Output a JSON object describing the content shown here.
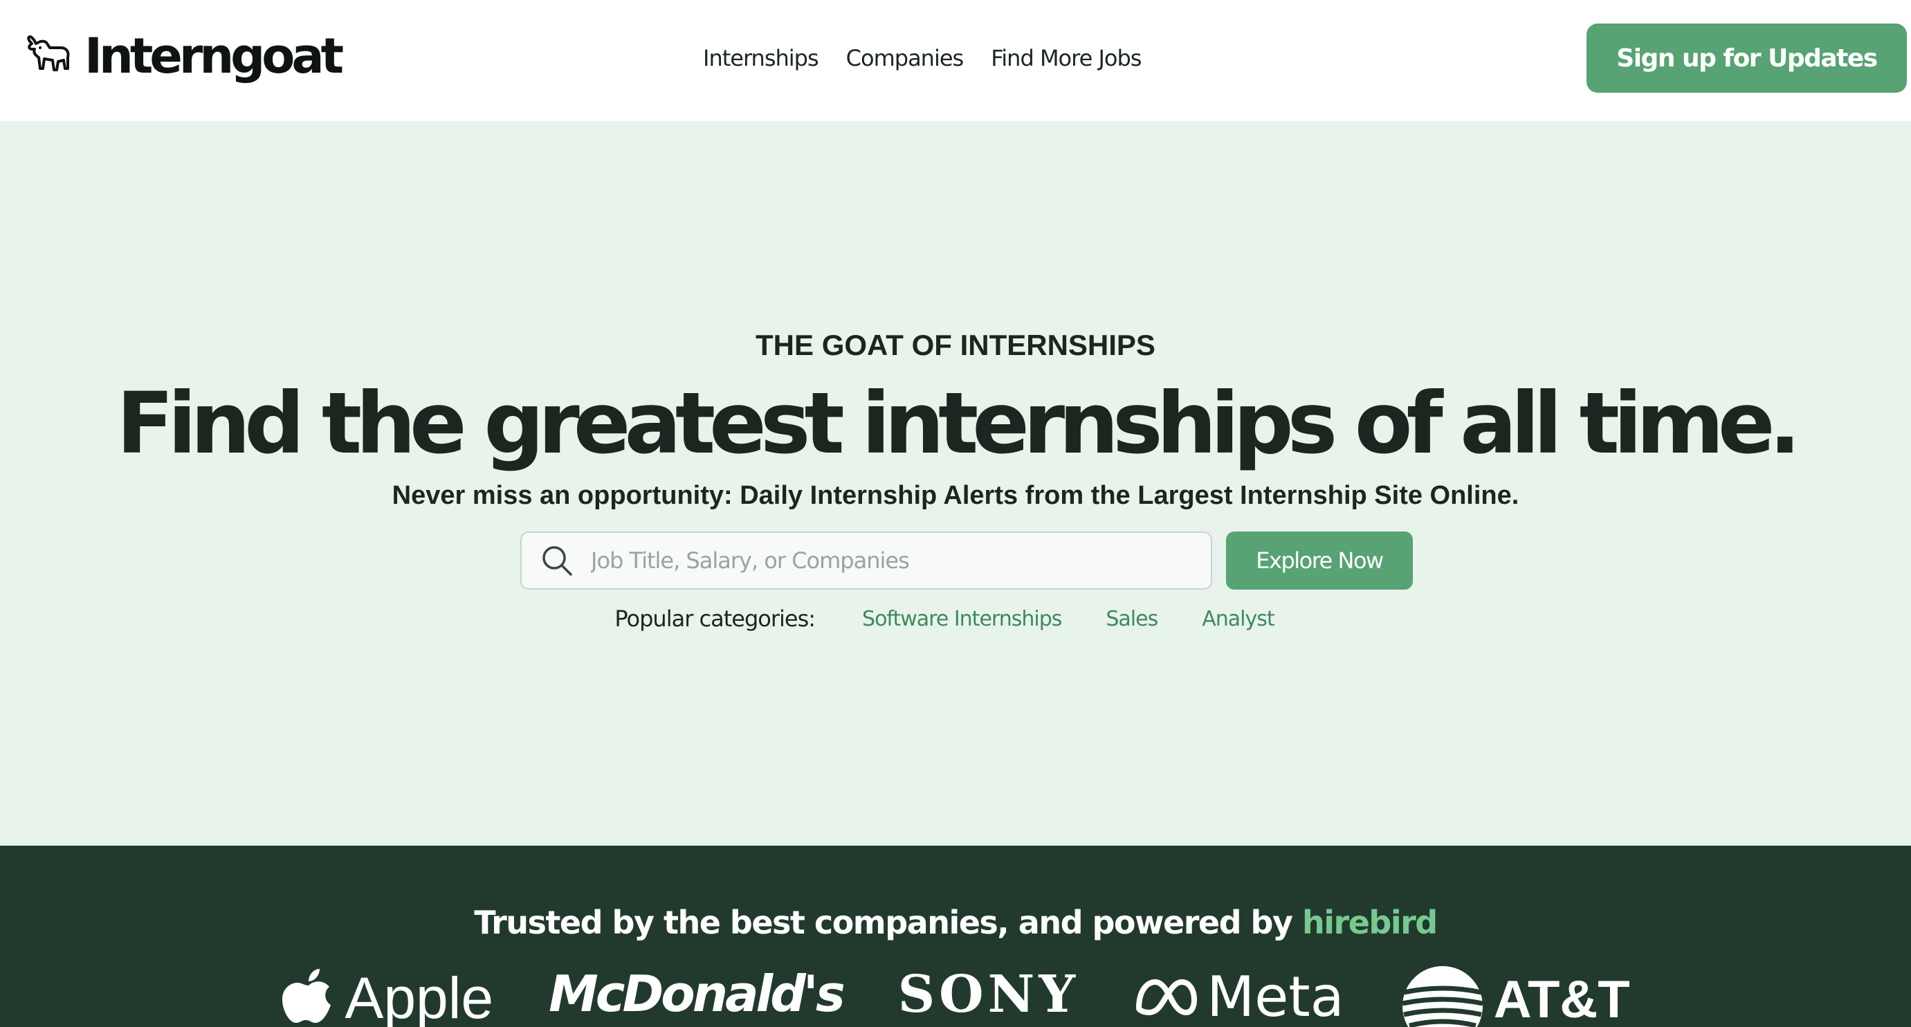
{
  "header": {
    "logo_text": "Interngoat",
    "nav": [
      "Internships",
      "Companies",
      "Find More Jobs"
    ],
    "signup_label": "Sign up for Updates"
  },
  "hero": {
    "eyebrow": "THE GOAT OF INTERNSHIPS",
    "headline": "Find the greatest internships of all time.",
    "subhead": "Never miss an opportunity: Daily Internship Alerts from the Largest Internship Site Online.",
    "search_placeholder": "Job Title, Salary, or Companies",
    "search_value": "",
    "explore_label": "Explore Now",
    "categories_label": "Popular categories:",
    "categories": [
      "Software Internships",
      "Sales",
      "Analyst"
    ]
  },
  "trusted": {
    "heading": "Trusted by the best companies, and powered by",
    "powered_by": "hirebird",
    "logos": [
      "Apple",
      "McDonald's",
      "SONY",
      "Meta",
      "AT&T"
    ]
  },
  "colors": {
    "accent": "#57a373",
    "hero_bg": "#e8f3ec",
    "trusted_bg": "#223a2d",
    "category_link": "#3f8a5c",
    "hirebird": "#78c98f"
  },
  "icons": {
    "logo": "goat-icon",
    "search": "search-icon",
    "apple": "apple-logo-icon",
    "meta": "meta-infinity-icon",
    "att": "att-globe-icon"
  }
}
